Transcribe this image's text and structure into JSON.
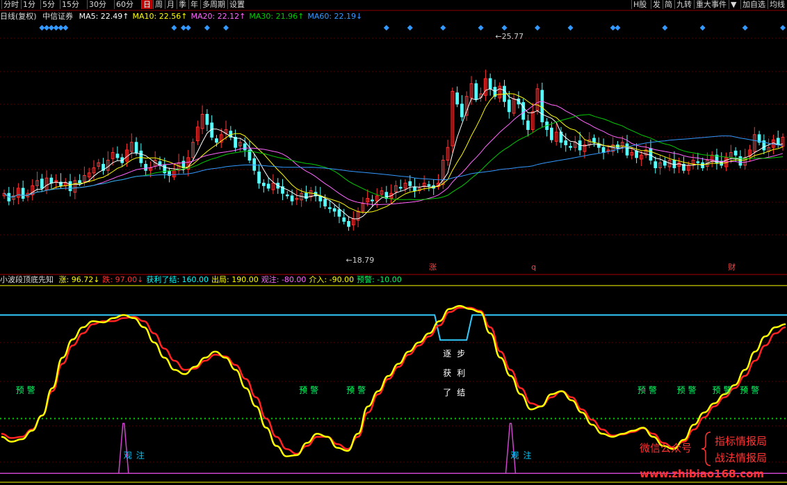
{
  "toolbar": {
    "left": [
      "分时",
      "1分",
      "5分",
      "15分",
      "30分",
      "60分",
      "日",
      "周",
      "月",
      "季",
      "年",
      "多周期",
      "设置"
    ],
    "active": "日",
    "right": [
      "H股",
      "发",
      "简",
      "九转",
      "重大事件",
      "▼",
      "加自选",
      "均线"
    ]
  },
  "price_header": {
    "period": "日线(复权)",
    "stock": "中信证券",
    "ma": [
      {
        "label": "MA5: 22.49↑",
        "color": "#ffffff"
      },
      {
        "label": "MA10: 22.56↑",
        "color": "#ffff00"
      },
      {
        "label": "MA20: 22.12↑",
        "color": "#ff66ff"
      },
      {
        "label": "MA30: 21.96↑",
        "color": "#00cc00"
      },
      {
        "label": "MA60: 22.19↓",
        "color": "#3399ff"
      }
    ]
  },
  "indicator_header": {
    "name": "小波段顶底先知",
    "items": [
      {
        "label": "涨: 96.72↓",
        "color": "#ffff00"
      },
      {
        "label": "跌: 97.00↓",
        "color": "#ff3333"
      },
      {
        "label": "获利了结: 160.00",
        "color": "#00ffff"
      },
      {
        "label": "出局: 190.00",
        "color": "#ffff00"
      },
      {
        "label": "观注: -80.00",
        "color": "#ff66ff"
      },
      {
        "label": "介入: -90.00",
        "color": "#ffff00"
      },
      {
        "label": "预警: -10.00",
        "color": "#00ff66"
      }
    ]
  },
  "chart_data": [
    {
      "type": "candlestick",
      "title": "中信证券 日线(复权)",
      "ylim": [
        17.5,
        27.2
      ],
      "colors": {
        "up": "#ff3333",
        "down": "#54ffff",
        "ma5": "#ffffff",
        "ma10": "#ffff00",
        "ma20": "#ff66ff",
        "ma30": "#00cc00",
        "ma60": "#3399ff",
        "diamond": "#3399ff"
      },
      "annotations": [
        {
          "text": "25.77",
          "kind": "high"
        },
        {
          "text": "18.79",
          "kind": "low"
        },
        {
          "text": "涨",
          "color": "#ff4444"
        },
        {
          "text": "q",
          "color": "#ff4444"
        },
        {
          "text": "财",
          "color": "#ff4444"
        }
      ],
      "closes": [
        20.6,
        20.3,
        20.5,
        20.8,
        20.4,
        20.6,
        20.9,
        21.1,
        20.8,
        21.2,
        21.0,
        21.1,
        20.9,
        21.0,
        20.7,
        21.1,
        21.0,
        21.3,
        21.4,
        21.6,
        21.8,
        21.5,
        21.9,
        22.2,
        22.0,
        21.8,
        22.3,
        22.6,
        22.2,
        21.8,
        21.5,
        21.6,
        21.9,
        21.7,
        21.4,
        21.3,
        21.5,
        21.8,
        21.6,
        22.0,
        22.6,
        23.2,
        23.7,
        23.3,
        22.8,
        22.6,
        22.9,
        23.1,
        22.8,
        22.4,
        22.6,
        22.3,
        21.9,
        21.5,
        21.0,
        20.9,
        20.8,
        21.0,
        20.8,
        20.6,
        20.5,
        20.3,
        20.4,
        20.6,
        20.4,
        20.7,
        20.5,
        20.3,
        20.1,
        20.0,
        19.9,
        19.7,
        19.5,
        19.3,
        19.6,
        19.9,
        20.2,
        20.4,
        20.3,
        20.5,
        20.7,
        20.4,
        20.6,
        20.9,
        20.8,
        21.0,
        20.9,
        20.7,
        20.8,
        21.0,
        20.9,
        20.8,
        21.0,
        21.9,
        22.4,
        24.6,
        24.1,
        23.6,
        24.4,
        24.9,
        24.3,
        24.5,
        25.1,
        24.7,
        24.4,
        24.8,
        24.2,
        23.8,
        24.3,
        24.1,
        23.5,
        23.1,
        23.8,
        24.7,
        23.4,
        23.1,
        22.7,
        23.0,
        22.6,
        22.5,
        22.4,
        22.6,
        22.3,
        22.5,
        22.7,
        22.6,
        22.4,
        22.2,
        22.3,
        22.5,
        22.4,
        22.6,
        22.1,
        22.2,
        22.0,
        22.1,
        22.3,
        21.9,
        21.6,
        21.8,
        21.7,
        21.9,
        21.6,
        21.8,
        21.5,
        21.7,
        21.9,
        21.8,
        21.6,
        21.9,
        22.1,
        21.8,
        21.7,
        22.0,
        22.2,
        22.1,
        21.7,
        22.0,
        22.3,
        22.9,
        22.6,
        22.3,
        22.4,
        22.7,
        22.5,
        22.8
      ]
    },
    {
      "type": "line",
      "title": "小波段顶底先知",
      "ylim": [
        -110,
        205
      ],
      "levels": {
        "profit": 160,
        "warn": -10,
        "base": -100
      },
      "series": [
        {
          "name": "涨",
          "color": "#ffff00",
          "values": [
            -40,
            -48,
            -44,
            -30,
            -5,
            40,
            90,
            120,
            140,
            150,
            148,
            155,
            160,
            155,
            140,
            115,
            90,
            70,
            63,
            75,
            90,
            100,
            90,
            70,
            40,
            10,
            -25,
            -55,
            -72,
            -70,
            -50,
            -35,
            -40,
            -58,
            -63,
            -35,
            10,
            35,
            60,
            80,
            100,
            115,
            130,
            150,
            170,
            175,
            170,
            165,
            130,
            90,
            60,
            30,
            5,
            10,
            30,
            35,
            20,
            0,
            -20,
            -35,
            -40,
            -35,
            -30,
            -25,
            -40,
            -55,
            -60,
            -45,
            -20,
            0,
            15,
            30,
            45,
            70,
            100,
            125,
            140,
            145
          ]
        },
        {
          "name": "跌",
          "color": "#ff2222",
          "values": [
            -35,
            -42,
            -40,
            -28,
            -5,
            35,
            80,
            110,
            130,
            145,
            150,
            150,
            155,
            157,
            150,
            130,
            105,
            85,
            70,
            72,
            85,
            95,
            92,
            78,
            55,
            25,
            -10,
            -40,
            -60,
            -68,
            -55,
            -40,
            -40,
            -52,
            -60,
            -40,
            0,
            30,
            55,
            75,
            95,
            110,
            125,
            143,
            165,
            172,
            172,
            167,
            140,
            100,
            70,
            40,
            15,
            10,
            25,
            35,
            25,
            5,
            -12,
            -28,
            -38,
            -36,
            -32,
            -26,
            -35,
            -50,
            -58,
            -48,
            -28,
            -8,
            10,
            25,
            40,
            60,
            85,
            110,
            130,
            140
          ]
        },
        {
          "name": "观注",
          "color": "#cc44cc",
          "spikes_at": [
            12,
            50
          ]
        }
      ],
      "text_labels": [
        {
          "text": "预警",
          "color": "#00ff66"
        },
        {
          "text": "预警",
          "color": "#00ff66"
        },
        {
          "text": "预警",
          "color": "#00ff66"
        },
        {
          "text": "预警",
          "color": "#00ff66"
        },
        {
          "text": "预警",
          "color": "#00ff66"
        },
        {
          "text": "预警",
          "color": "#00ff66"
        },
        {
          "text": "预警",
          "color": "#00ff66"
        },
        {
          "text": "观注",
          "color": "#00ccff"
        },
        {
          "text": "观注",
          "color": "#00ccff"
        },
        {
          "text": "逐步",
          "color": "#ffffff"
        },
        {
          "text": "获利",
          "color": "#ffffff"
        },
        {
          "text": "了结",
          "color": "#ffffff"
        }
      ]
    }
  ],
  "watermark": {
    "line1": "微信公众号",
    "line2a": "指标情报局",
    "line2b": "战法情报局",
    "url": "www.zhibiao168.com"
  }
}
